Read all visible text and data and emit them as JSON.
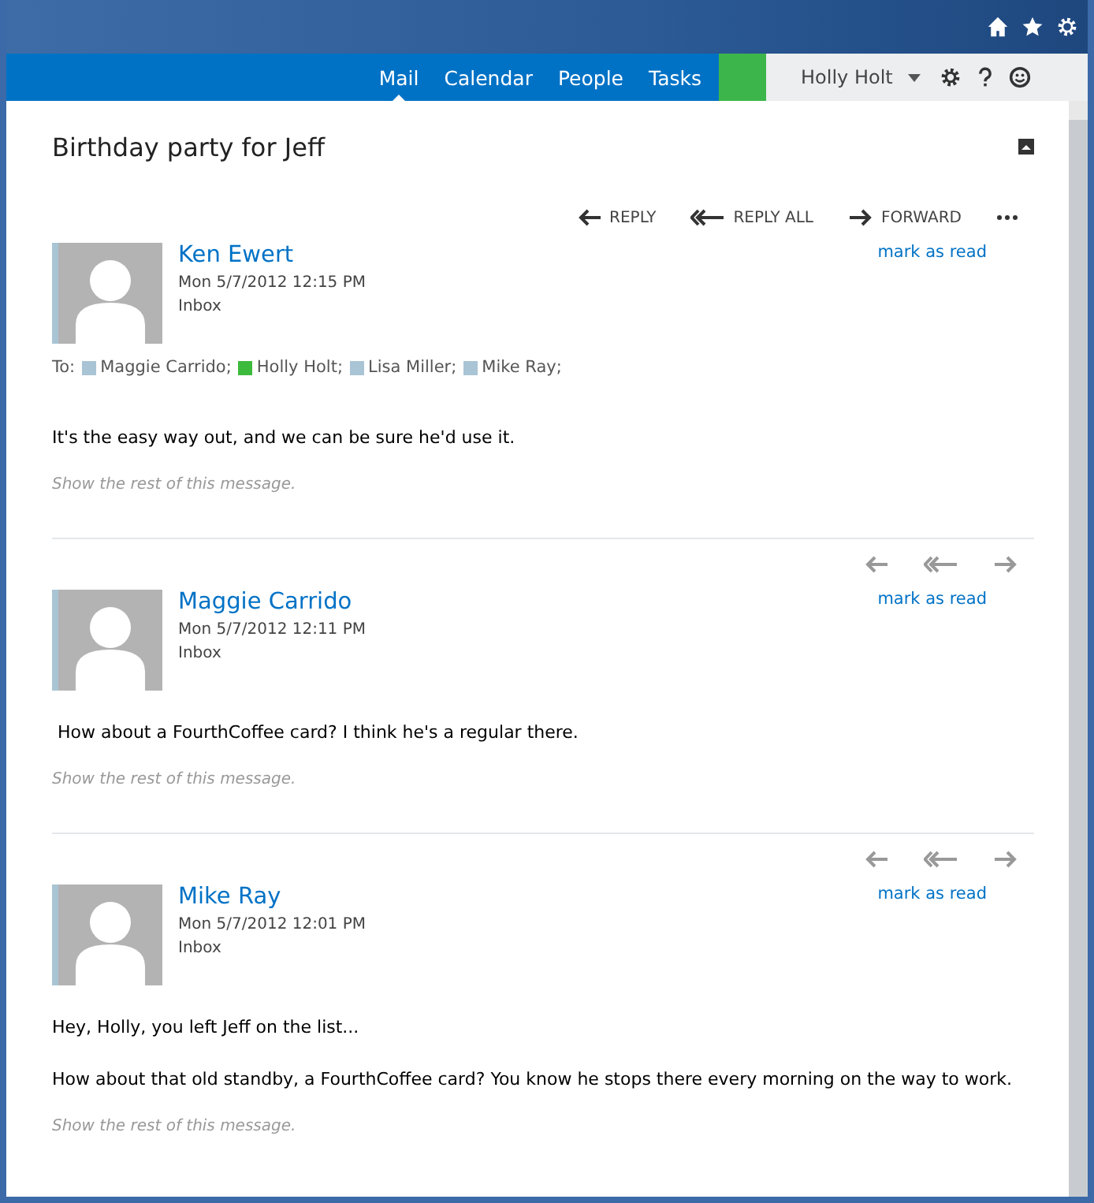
{
  "nav": {
    "tabs": [
      {
        "label": "Mail",
        "selected": true
      },
      {
        "label": "Calendar",
        "selected": false
      },
      {
        "label": "People",
        "selected": false
      },
      {
        "label": "Tasks",
        "selected": false
      }
    ],
    "user": "Holly Holt"
  },
  "conversation": {
    "subject": "Birthday party for Jeff",
    "messages": [
      {
        "sender": "Ken Ewert",
        "date": "Mon 5/7/2012 12:15 PM",
        "folder": "Inbox",
        "mark": "mark as read",
        "actions": [
          {
            "kind": "reply",
            "label": "REPLY"
          },
          {
            "kind": "reply-all",
            "label": "REPLY ALL"
          },
          {
            "kind": "forward",
            "label": "FORWARD"
          }
        ],
        "more": true,
        "to_label": "To:",
        "recipients": [
          {
            "name": "Maggie Carrido;",
            "color": "#a9c4d4"
          },
          {
            "name": "Holly Holt;",
            "color": "#3cba3c"
          },
          {
            "name": "Lisa Miller;",
            "color": "#a9c4d4"
          },
          {
            "name": "Mike Ray;",
            "color": "#a9c4d4"
          }
        ],
        "body": [
          "It's the easy way out, and we can be sure he'd use it."
        ],
        "show_rest": "Show the rest of this message."
      },
      {
        "sender": "Maggie Carrido",
        "date": "Mon 5/7/2012 12:11 PM",
        "folder": "Inbox",
        "mark": "mark as read",
        "actions": [
          {
            "kind": "reply"
          },
          {
            "kind": "reply-all"
          },
          {
            "kind": "forward"
          }
        ],
        "more": false,
        "body": [
          " How about a FourthCoffee card? I think he's a regular there."
        ],
        "show_rest": "Show the rest of this message."
      },
      {
        "sender": "Mike Ray",
        "date": "Mon 5/7/2012 12:01 PM",
        "folder": "Inbox",
        "mark": "mark as read",
        "actions": [
          {
            "kind": "reply"
          },
          {
            "kind": "reply-all"
          },
          {
            "kind": "forward"
          }
        ],
        "more": false,
        "body": [
          "Hey, Holly, you left Jeff on the list...",
          "How about that old standby, a FourthCoffee card? You know he stops there every morning on the way to work."
        ],
        "show_rest": "Show the rest of this message."
      }
    ]
  }
}
